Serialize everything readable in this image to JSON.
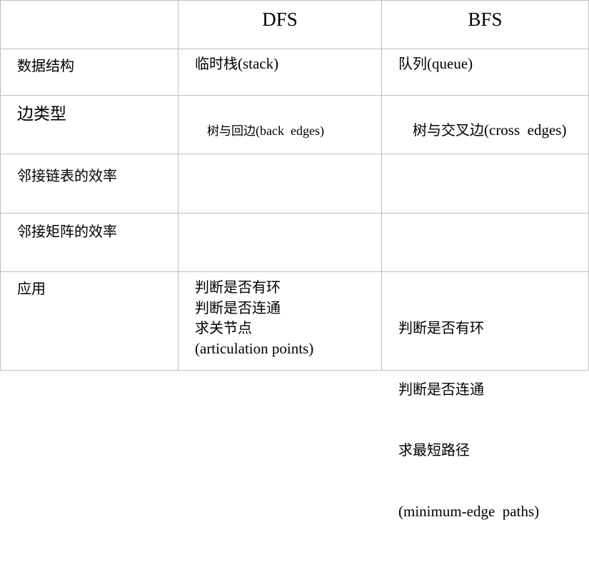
{
  "header": {
    "col_empty": "",
    "col_dfs": "DFS",
    "col_bfs": "BFS"
  },
  "rows": {
    "data_structure": {
      "label": "数据结构",
      "dfs_zh": "临时栈",
      "dfs_en": "(stack)",
      "bfs_zh": "队列",
      "bfs_en": "(queue)"
    },
    "edge_type": {
      "label": "边类型",
      "dfs_zh": "树与回边",
      "dfs_en": "(back  edges)",
      "bfs_zh": "树与交叉边",
      "bfs_en": "(cross  edges)"
    },
    "adj_list": {
      "label": "邻接链表的效率",
      "dfs": "",
      "bfs": ""
    },
    "adj_matrix": {
      "label": "邻接矩阵的效率",
      "dfs": "",
      "bfs": ""
    },
    "applications": {
      "label": "应用",
      "dfs_lines": [
        "判断是否有环",
        "判断是否连通",
        "求关节点"
      ],
      "dfs_en": "(articulation points)",
      "bfs_lines": [
        "判断是否有环",
        "判断是否连通",
        "求最短路径"
      ],
      "bfs_en": "(minimum-edge  paths)"
    }
  },
  "colors": {
    "grid": "#bdbdbd",
    "text": "#000000",
    "background": "#ffffff"
  }
}
